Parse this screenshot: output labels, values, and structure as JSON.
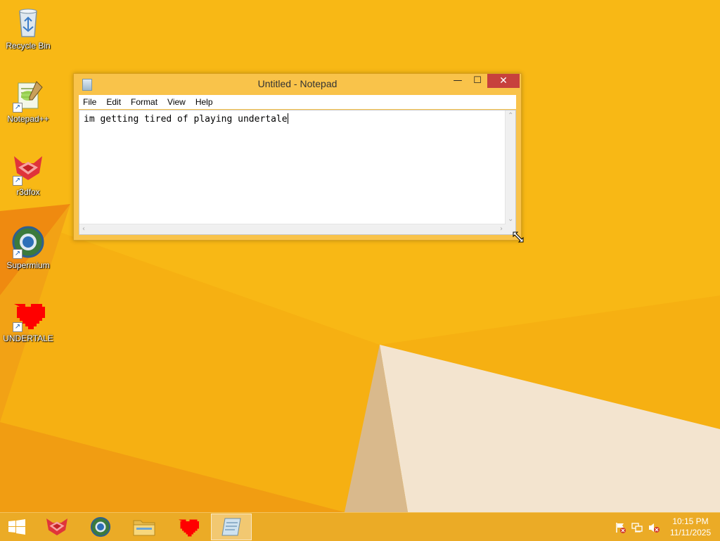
{
  "desktop": {
    "icons": [
      {
        "label": "Recycle Bin",
        "icon": "recycle-bin-icon"
      },
      {
        "label": "Notepad++",
        "icon": "notepadpp-icon"
      },
      {
        "label": "r3dfox",
        "icon": "r3dfox-icon"
      },
      {
        "label": "Supermium",
        "icon": "supermium-icon"
      },
      {
        "label": "UNDERTALE",
        "icon": "undertale-heart-icon"
      }
    ]
  },
  "window": {
    "title": "Untitled - Notepad",
    "controls": {
      "minimize": "—",
      "maximize": "☐",
      "close": "✕"
    },
    "menu": [
      "File",
      "Edit",
      "Format",
      "View",
      "Help"
    ],
    "content": "im getting tired of playing undertale"
  },
  "taskbar": {
    "pinned": [
      {
        "name": "start",
        "icon": "windows-logo-icon"
      },
      {
        "name": "r3dfox",
        "icon": "r3dfox-icon"
      },
      {
        "name": "supermium",
        "icon": "supermium-icon"
      },
      {
        "name": "file-explorer",
        "icon": "folder-icon"
      },
      {
        "name": "undertale",
        "icon": "undertale-heart-icon"
      },
      {
        "name": "notepad",
        "icon": "notepad-icon",
        "active": true
      }
    ],
    "tray": [
      "action-center-flag-icon",
      "network-icon",
      "volume-muted-icon"
    ],
    "time": "10:15 PM",
    "date": "11/11/2025"
  },
  "colors": {
    "background": "#f6b012",
    "window_frame": "#f9c34a",
    "close_button": "#c7413d"
  }
}
